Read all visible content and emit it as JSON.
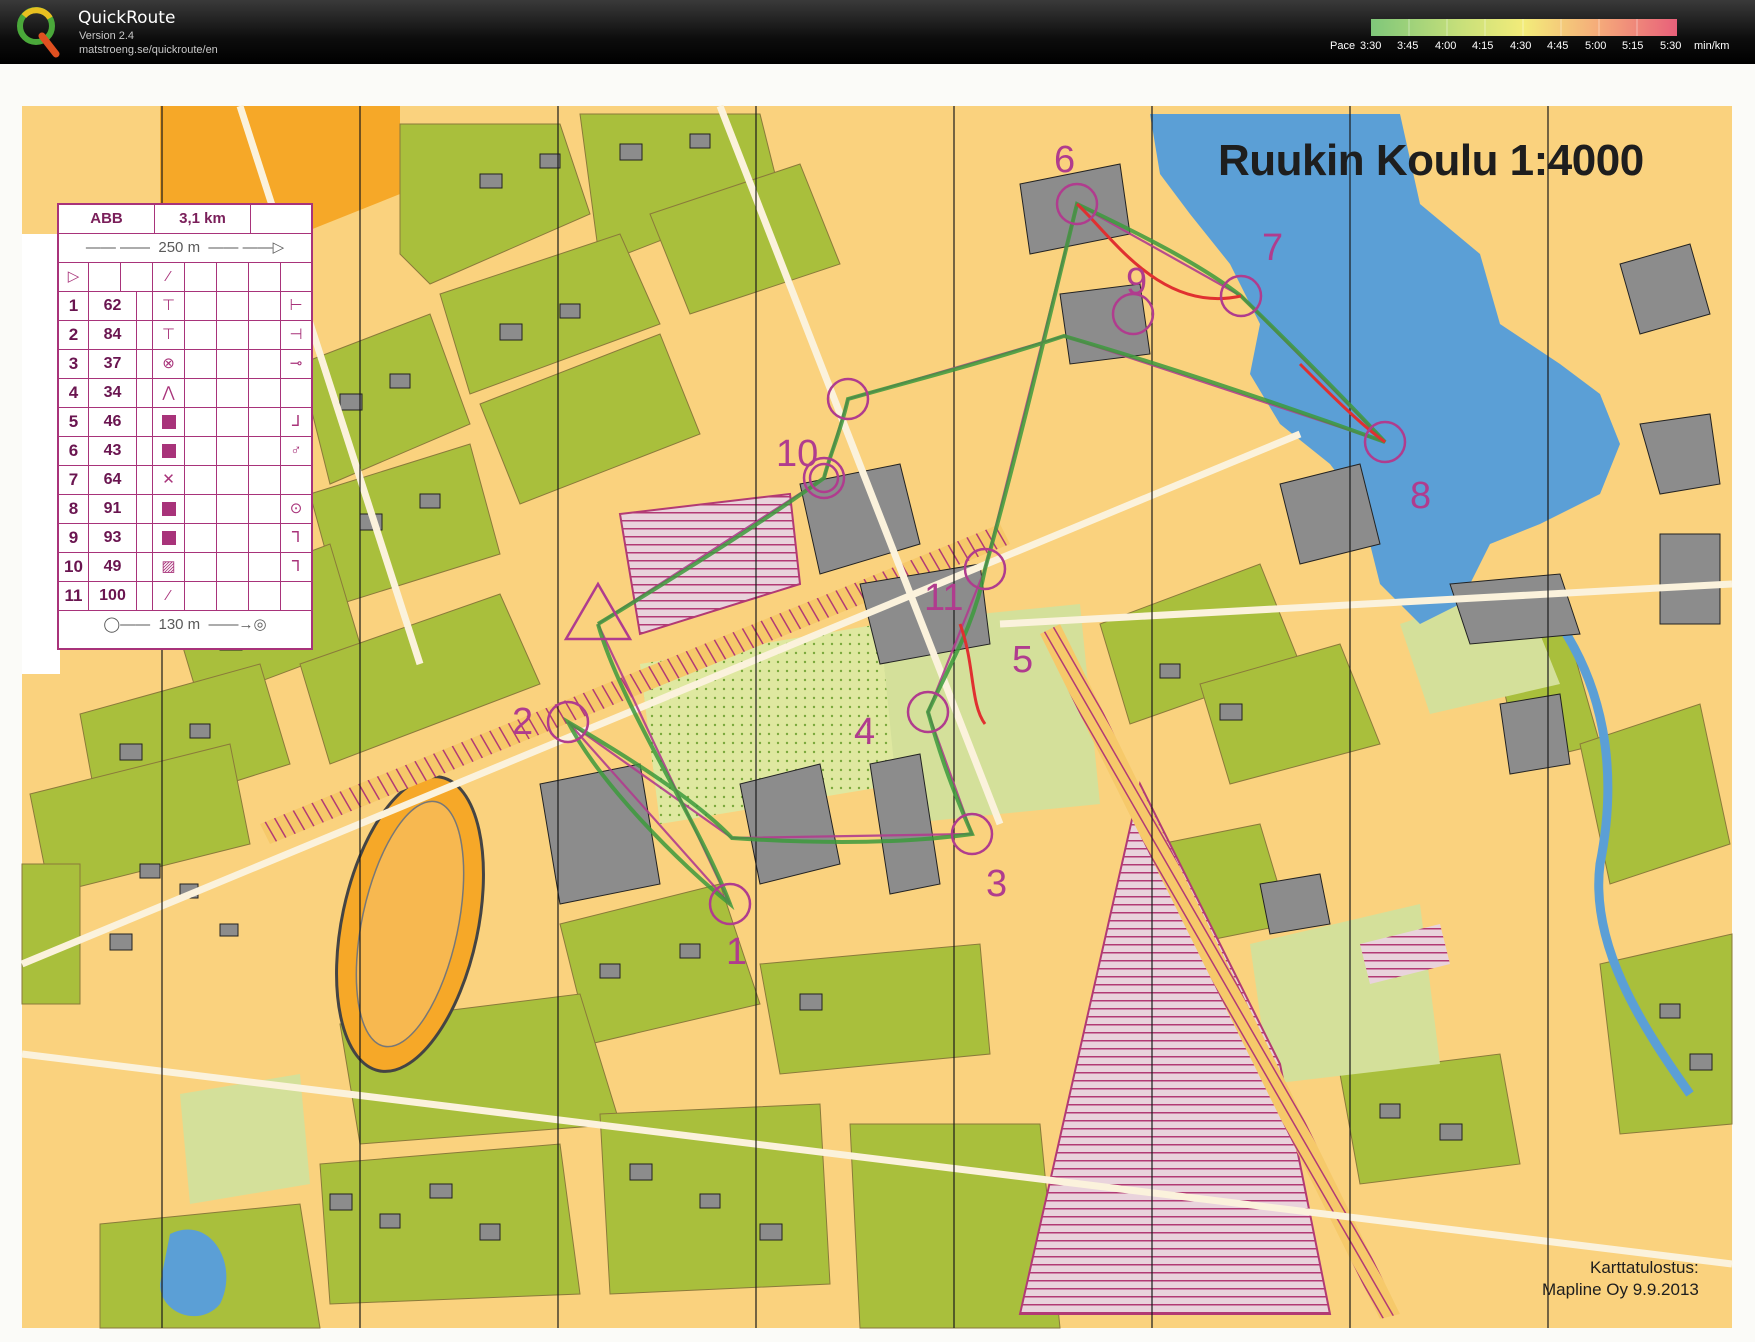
{
  "app": {
    "name": "QuickRoute",
    "version": "Version 2.4",
    "url": "matstroeng.se/quickroute/en"
  },
  "pace_scale": {
    "prefix": "Pace",
    "ticks": [
      "3:30",
      "3:45",
      "4:00",
      "4:15",
      "4:30",
      "4:45",
      "5:00",
      "5:15",
      "5:30"
    ],
    "unit": "min/km",
    "colors": [
      "#7fc77a",
      "#a8d67a",
      "#d3e47a",
      "#f3ec7a",
      "#f7c97a",
      "#f5a97a",
      "#f0857a",
      "#e8607a"
    ]
  },
  "map": {
    "title": "Ruukin Koulu 1:4000",
    "credit_line1": "Karttatulostus:",
    "credit_line2": "Mapline Oy 9.9.2013",
    "control_numbers": [
      "1",
      "2",
      "3",
      "4",
      "5",
      "6",
      "7",
      "8",
      "9",
      "10",
      "11"
    ],
    "colors": {
      "open_land": "#f6a828",
      "rough_open": "#fad27e",
      "forest_green": "#a9bf3c",
      "light_green": "#d4e09a",
      "water": "#5b9fd6",
      "building": "#8c8c8c",
      "course_purple": "#b03c8e",
      "route_green": "#3c9a3c",
      "route_red": "#e03030"
    }
  },
  "course": {
    "class": "ABB",
    "length": "3,1 km",
    "start_distance": "250 m",
    "finish_distance": "130 m",
    "controls": [
      {
        "num": "1",
        "code": "62"
      },
      {
        "num": "2",
        "code": "84"
      },
      {
        "num": "3",
        "code": "37"
      },
      {
        "num": "4",
        "code": "34"
      },
      {
        "num": "5",
        "code": "46"
      },
      {
        "num": "6",
        "code": "43"
      },
      {
        "num": "7",
        "code": "64"
      },
      {
        "num": "8",
        "code": "91"
      },
      {
        "num": "9",
        "code": "93"
      },
      {
        "num": "10",
        "code": "49"
      },
      {
        "num": "11",
        "code": "100"
      }
    ]
  }
}
